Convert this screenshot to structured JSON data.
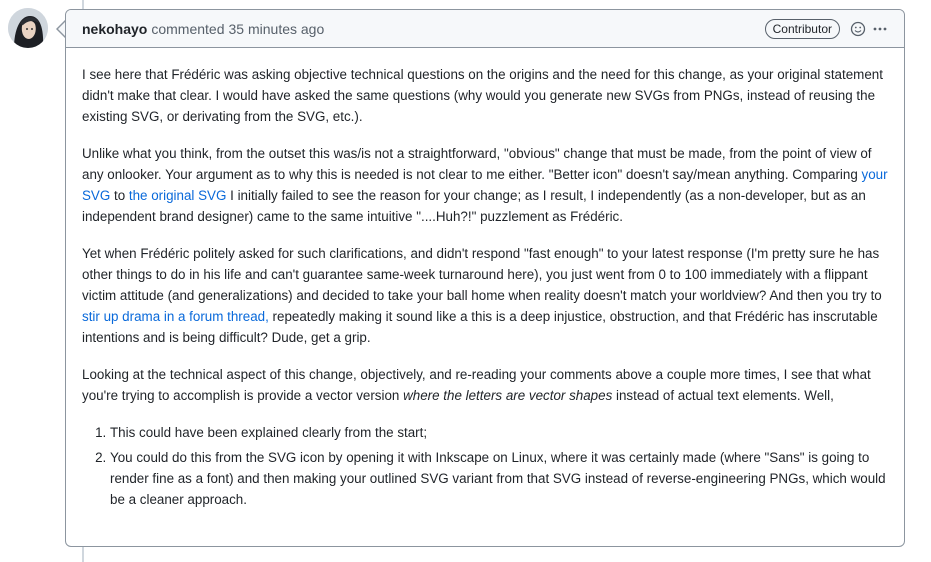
{
  "comment": {
    "author": "nekohayo",
    "action": "commented",
    "time": "35 minutes ago",
    "badge": "Contributor",
    "paragraphs": [
      "I see here that Frédéric was asking objective technical questions on the origins and the need for this change, as your original statement didn't make that clear. I would have asked the same questions (why would you generate new SVGs from PNGs, instead of reusing the existing SVG, or derivating from the SVG, etc.)."
    ],
    "p2": {
      "text1": "Unlike what you think, from the outset this was/is not a straightforward, \"obvious\" change that must be made, from the point of view of any onlooker. Your argument as to why this is needed is not clear to me either. \"Better icon\" doesn't say/mean anything. Comparing ",
      "link1": "your SVG",
      "text2": " to ",
      "link2": "the original SVG",
      "text3": " I initially failed to see the reason for your change; as I result, I independently (as a non-developer, but as an independent brand designer) came to the same intuitive \"....Huh?!\" puzzlement as Frédéric."
    },
    "p3": {
      "text1": "Yet when Frédéric politely asked for such clarifications, and didn't respond \"fast enough\" to your latest response (I'm pretty sure he has other things to do in his life and can't guarantee same-week turnaround here), you just went from 0 to 100 immediately with a flippant victim attitude (and generalizations) and decided to take your ball home when reality doesn't match your worldview? And then you try to ",
      "link": "stir up drama in a forum thread,",
      "text2": " repeatedly making it sound like a this is a deep injustice, obstruction, and that Frédéric has inscrutable intentions and is being difficult? Dude, get a grip."
    },
    "p4": {
      "text1": "Looking at the technical aspect of this change, objectively, and re-reading your comments above a couple more times, I see that what you're trying to accomplish is provide a vector version ",
      "em": "where the letters are vector shapes",
      "text2": " instead of actual text elements. Well,"
    },
    "list": [
      "This could have been explained clearly from the start;",
      "You could do this from the SVG icon by opening it with Inkscape on Linux, where it was certainly made (where \"Sans\" is going to render fine as a font) and then making your outlined SVG variant from that SVG instead of reverse-engineering PNGs, which would be a cleaner approach."
    ]
  },
  "icons": [
    "avatar",
    "smiley-icon",
    "kebab-menu-icon"
  ]
}
